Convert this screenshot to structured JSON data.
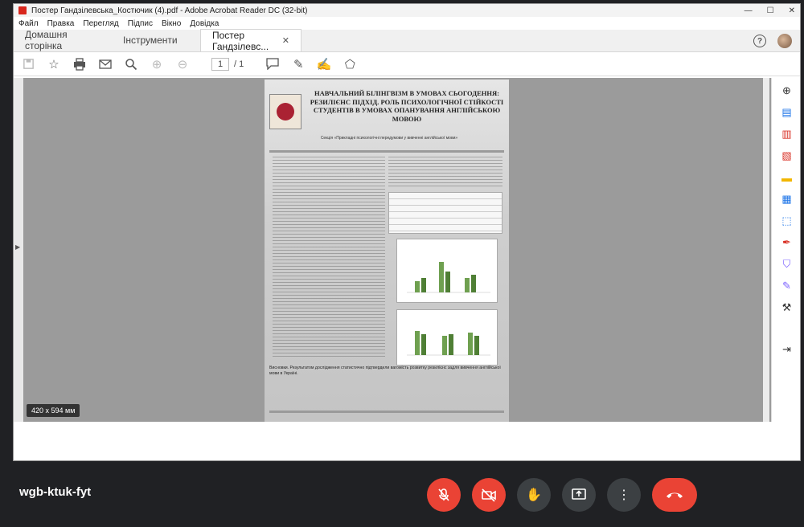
{
  "window": {
    "title": "Постер Гандзілевська_Костючик (4).pdf - Adobe Acrobat Reader DC (32-bit)",
    "controls": [
      "—",
      "☐",
      "✕"
    ]
  },
  "menu": [
    "Файл",
    "Правка",
    "Перегляд",
    "Підпис",
    "Вікно",
    "Довідка"
  ],
  "tabs": {
    "home": "Домашня сторінка",
    "tools": "Інструменти",
    "document": "Постер Гандзілевс...",
    "close": "✕",
    "help": "?"
  },
  "toolbar": {
    "page_current": "1",
    "page_total": "/ 1"
  },
  "poster": {
    "title": "НАВЧАЛЬНИЙ БІЛІНГВІЗМ В УМОВАХ СЬОГОДЕННЯ: РЕЗИЛІЄНС ПІДХІД. РОЛЬ ПСИХОЛОГІЧНОЇ СТІЙКОСТІ СТУДЕНТІВ В УМОВАХ ОПАНУВАННЯ АНГЛІЙСЬКОЮ МОВОЮ",
    "subtitle": "Секція «Прикладні психологічні передумови у вивченні англійської мови»",
    "bottom_text": "Висновки. Результатом дослідження статистично підтвердили вагомість розвитку резилієнс задля вивчення англійської мови в Україні."
  },
  "page_size_label": "420 x 594 мм",
  "meeting": {
    "code": "wgb-ktuk-fyt"
  },
  "colors": {
    "end_call": "#ea4335",
    "mic_off": "#ea4335",
    "control_grey": "#3c4043"
  }
}
